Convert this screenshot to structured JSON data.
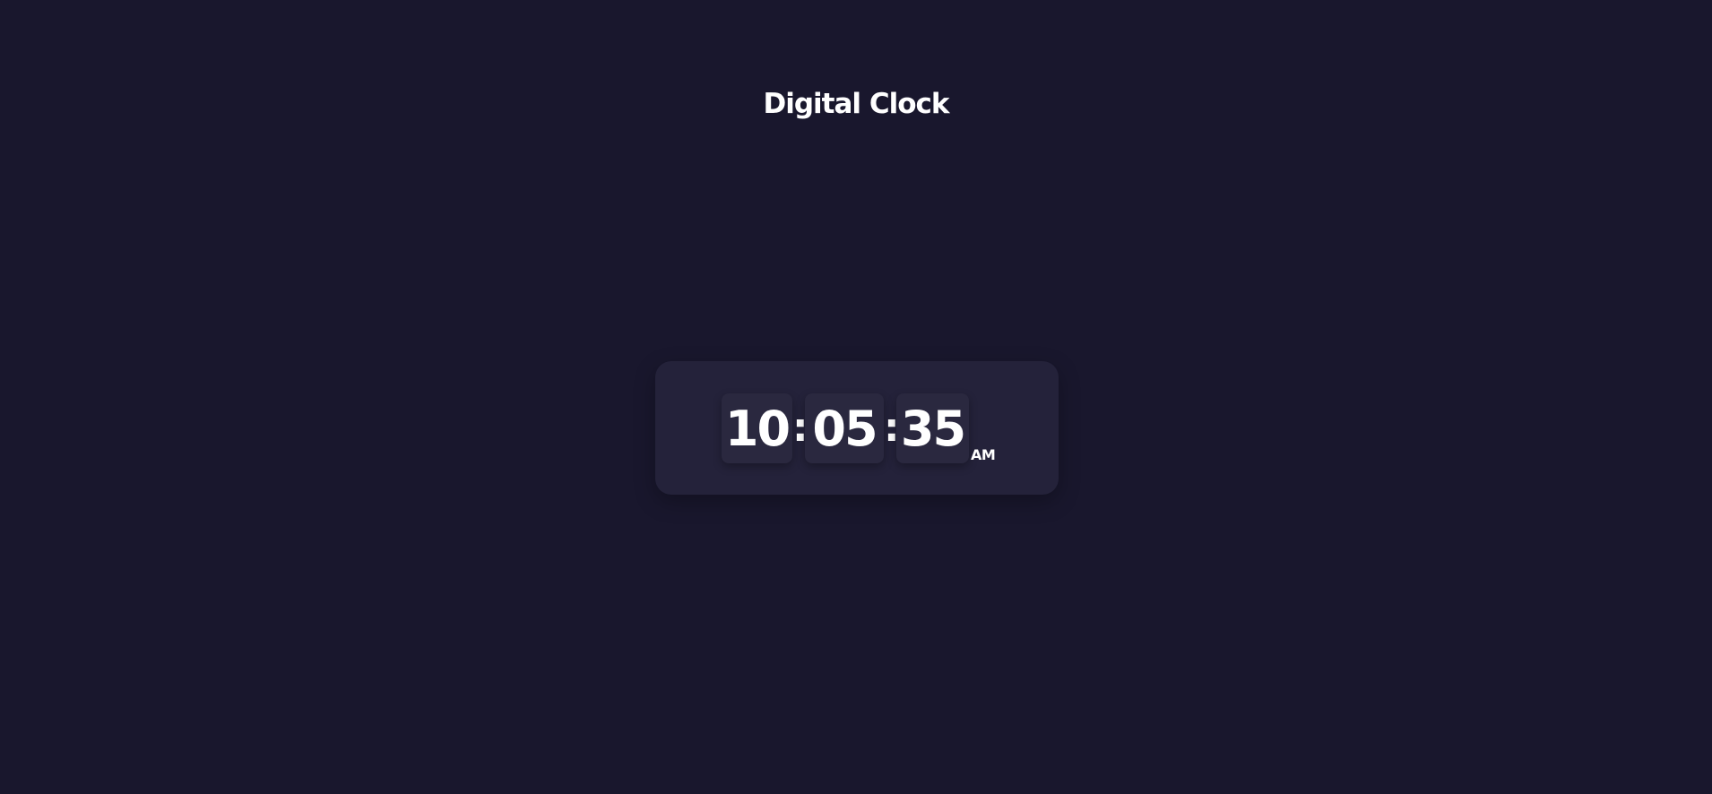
{
  "header": {
    "title": "Digital Clock"
  },
  "clock": {
    "hours": "10",
    "separator": ":",
    "minutes": "05",
    "seconds": "35",
    "period": "AM"
  },
  "colors": {
    "background": "#19172d",
    "card": "#24223a",
    "digit_box": "#2a283f",
    "text": "#ffffff"
  }
}
